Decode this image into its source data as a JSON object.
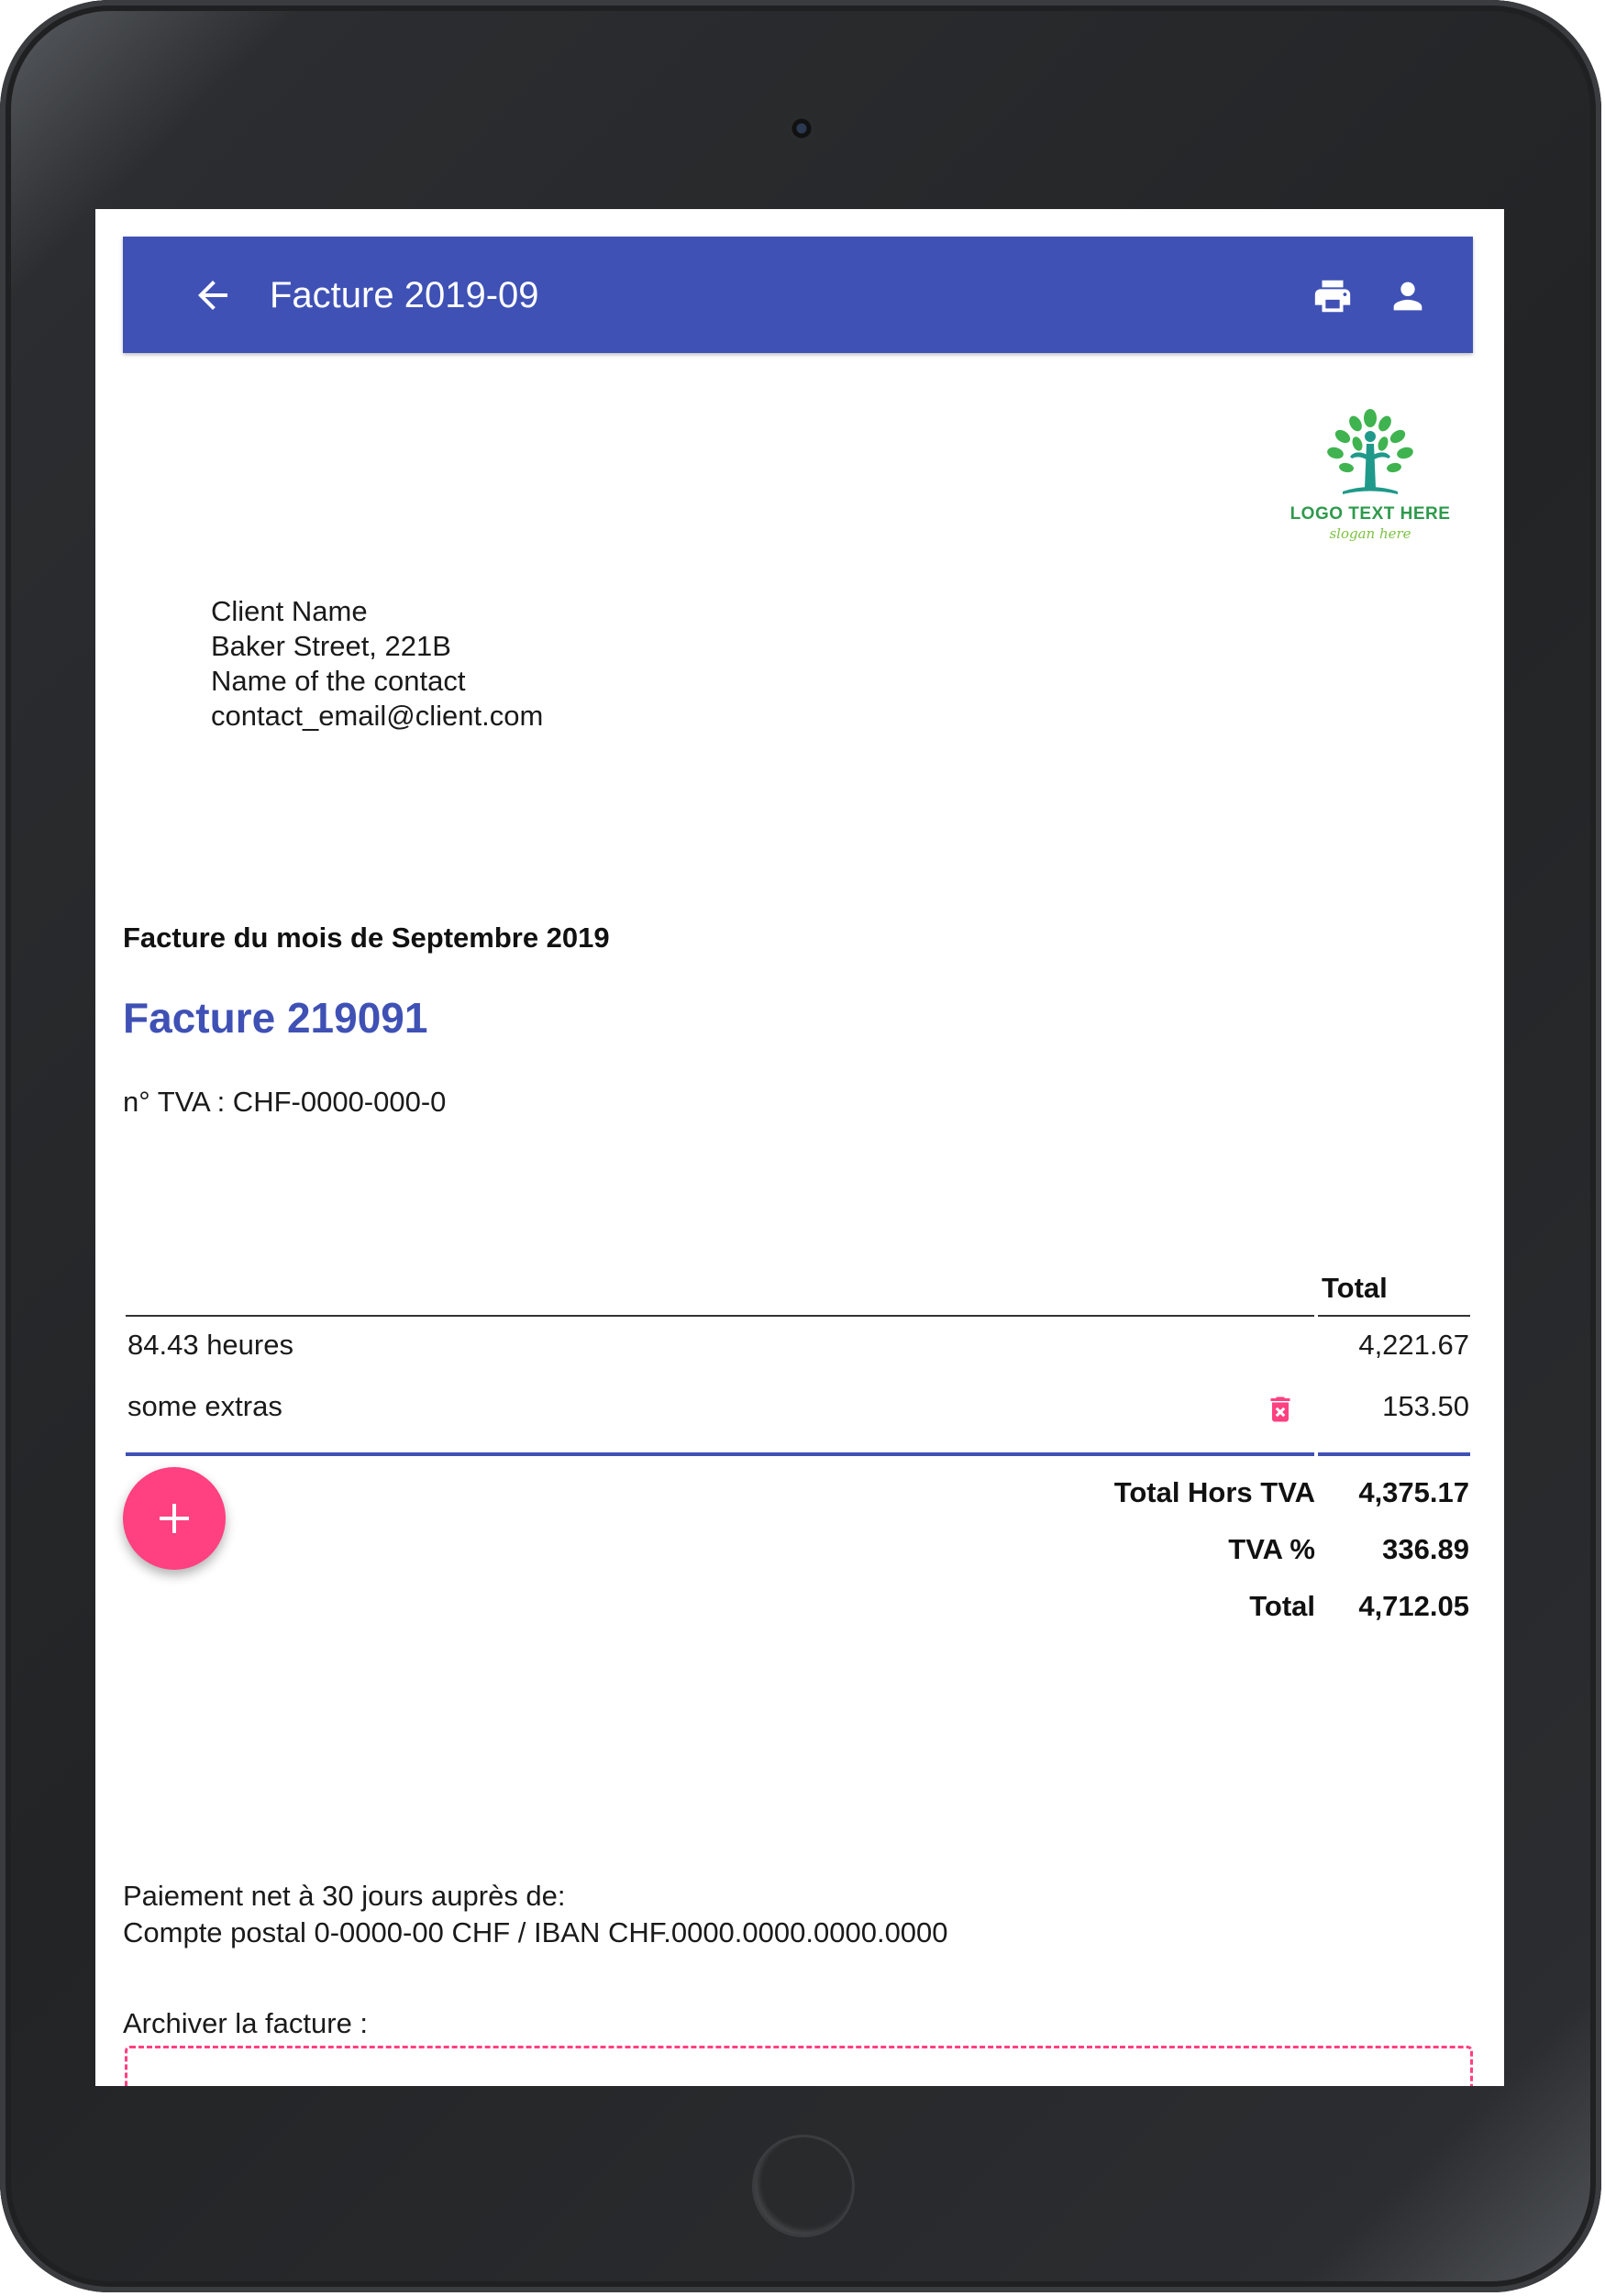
{
  "appbar": {
    "title": "Facture 2019-09",
    "back_icon": "arrow-back-icon",
    "print_icon": "print-icon",
    "account_icon": "person-icon",
    "color": "#3f51b5"
  },
  "logo": {
    "text": "LOGO TEXT HERE",
    "slogan": "slogan here"
  },
  "client": {
    "name": "Client Name",
    "street": "Baker Street, 221B",
    "contact": "Name of the contact",
    "email": "contact_email@client.com"
  },
  "invoice": {
    "subject": "Facture du mois de Septembre 2019",
    "title": "Facture 219091",
    "vat_number": "n° TVA : CHF-0000-000-0"
  },
  "table": {
    "total_header": "Total",
    "rows": [
      {
        "description": "84.43 heures",
        "amount": "4,221.67"
      },
      {
        "description": "some extras",
        "amount": "153.50"
      }
    ]
  },
  "summary": {
    "subtotal_label": "Total Hors TVA",
    "subtotal_value": "4,375.17",
    "vat_label": "TVA %",
    "vat_value": "336.89",
    "total_label": "Total",
    "total_value": "4,712.05"
  },
  "payment": {
    "line1": "Paiement net à 30 jours auprès de:",
    "line2": "Compte postal 0-0000-00 CHF / IBAN CHF.0000.0000.0000.0000"
  },
  "archive": {
    "label": "Archiver la facture :"
  },
  "colors": {
    "primary": "#3f51b5",
    "accent": "#ff4081"
  }
}
